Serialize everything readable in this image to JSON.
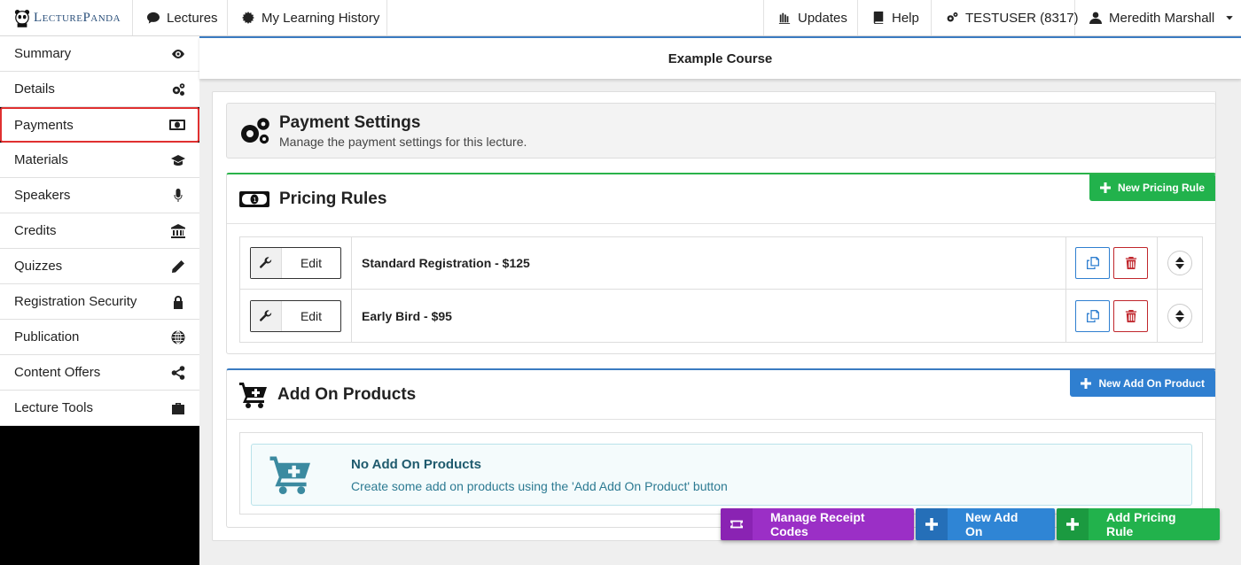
{
  "topbar": {
    "logo_text": "LecturePanda",
    "left_nav": [
      {
        "label": "Lectures",
        "icon": "comment-icon"
      },
      {
        "label": "My Learning History",
        "icon": "gear-icon"
      }
    ],
    "right_nav": [
      {
        "label": "Updates",
        "icon": "bullhorn-icon"
      },
      {
        "label": "Help",
        "icon": "book-icon"
      },
      {
        "label": "TESTUSER (8317)",
        "icon": "cogs-icon"
      },
      {
        "label": "Meredith Marshall",
        "icon": "user-icon",
        "dropdown": true
      }
    ]
  },
  "sidebar": {
    "items": [
      {
        "label": "Summary",
        "icon": "eye-icon"
      },
      {
        "label": "Details",
        "icon": "cogs-icon"
      },
      {
        "label": "Payments",
        "icon": "money-icon",
        "active": true
      },
      {
        "label": "Materials",
        "icon": "graduation-cap-icon"
      },
      {
        "label": "Speakers",
        "icon": "microphone-icon"
      },
      {
        "label": "Credits",
        "icon": "bank-icon"
      },
      {
        "label": "Quizzes",
        "icon": "pencil-icon"
      },
      {
        "label": "Registration Security",
        "icon": "lock-icon"
      },
      {
        "label": "Publication",
        "icon": "globe-icon"
      },
      {
        "label": "Content Offers",
        "icon": "share-icon"
      },
      {
        "label": "Lecture Tools",
        "icon": "briefcase-icon"
      }
    ]
  },
  "main": {
    "course_title": "Example Course",
    "settings": {
      "title": "Payment Settings",
      "subtitle": "Manage the payment settings for this lecture."
    },
    "pricing": {
      "title": "Pricing Rules",
      "new_button": "New Pricing Rule",
      "edit_label": "Edit",
      "rules": [
        {
          "name": "Standard Registration - $125"
        },
        {
          "name": "Early Bird - $95"
        }
      ]
    },
    "addons": {
      "title": "Add On Products",
      "new_button": "New Add On Product",
      "empty_title": "No Add On Products",
      "empty_text": "Create some add on products using the 'Add Add On Product' button"
    }
  },
  "actions": {
    "manage_receipt_codes": "Manage Receipt Codes",
    "new_add_on": "New Add On",
    "add_pricing_rule": "Add Pricing Rule"
  },
  "colors": {
    "green": "#22b24c",
    "blue": "#2f7fd0",
    "purple": "#9b2fc6",
    "danger": "#c0262c",
    "active_outline": "#e03030"
  }
}
